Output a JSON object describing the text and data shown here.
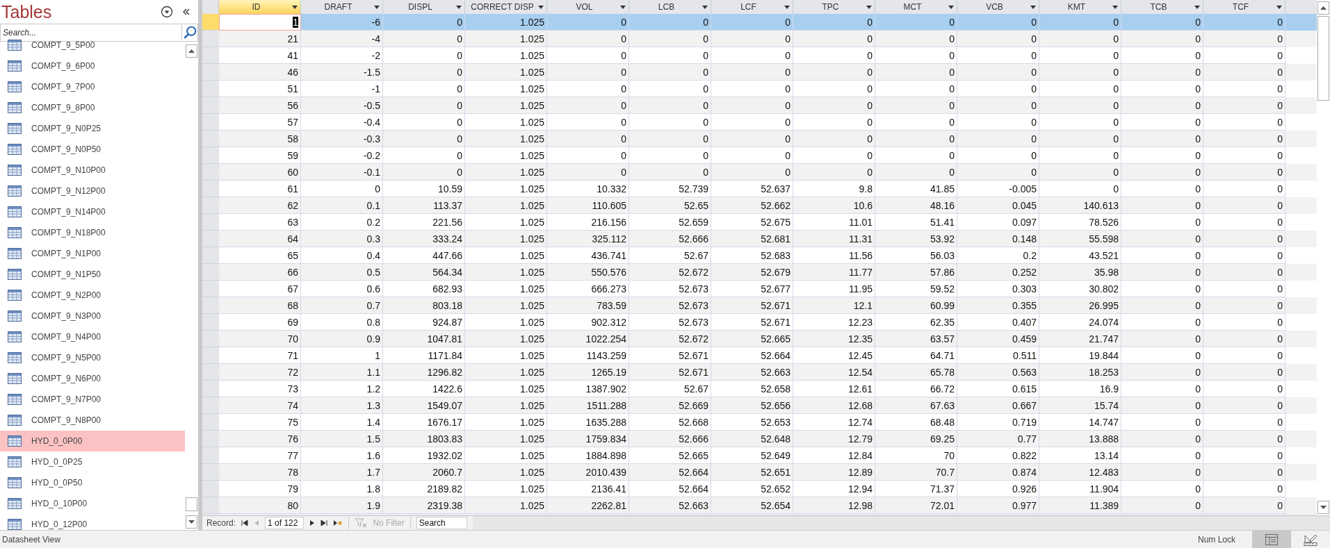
{
  "nav_pane": {
    "title": "Tables",
    "search": {
      "placeholder": "Search..."
    },
    "items": [
      {
        "label": "COMPT_9_5P00",
        "selected": false
      },
      {
        "label": "COMPT_9_6P00",
        "selected": false
      },
      {
        "label": "COMPT_9_7P00",
        "selected": false
      },
      {
        "label": "COMPT_9_8P00",
        "selected": false
      },
      {
        "label": "COMPT_9_N0P25",
        "selected": false
      },
      {
        "label": "COMPT_9_N0P50",
        "selected": false
      },
      {
        "label": "COMPT_9_N10P00",
        "selected": false
      },
      {
        "label": "COMPT_9_N12P00",
        "selected": false
      },
      {
        "label": "COMPT_9_N14P00",
        "selected": false
      },
      {
        "label": "COMPT_9_N18P00",
        "selected": false
      },
      {
        "label": "COMPT_9_N1P00",
        "selected": false
      },
      {
        "label": "COMPT_9_N1P50",
        "selected": false
      },
      {
        "label": "COMPT_9_N2P00",
        "selected": false
      },
      {
        "label": "COMPT_9_N3P00",
        "selected": false
      },
      {
        "label": "COMPT_9_N4P00",
        "selected": false
      },
      {
        "label": "COMPT_9_N5P00",
        "selected": false
      },
      {
        "label": "COMPT_9_N6P00",
        "selected": false
      },
      {
        "label": "COMPT_9_N7P00",
        "selected": false
      },
      {
        "label": "COMPT_9_N8P00",
        "selected": false
      },
      {
        "label": "HYD_0_0P00",
        "selected": true
      },
      {
        "label": "HYD_0_0P25",
        "selected": false
      },
      {
        "label": "HYD_0_0P50",
        "selected": false
      },
      {
        "label": "HYD_0_10P00",
        "selected": false
      },
      {
        "label": "HYD_0_12P00",
        "selected": false
      }
    ]
  },
  "table": {
    "columns": [
      "ID",
      "DRAFT",
      "DISPL",
      "CORRECT DISP",
      "VOL",
      "LCB",
      "LCF",
      "TPC",
      "MCT",
      "VCB",
      "KMT",
      "TCB",
      "TCF"
    ],
    "rows": [
      {
        "selected": true,
        "cells": [
          "1",
          "-6",
          "0",
          "1.025",
          "0",
          "0",
          "0",
          "0",
          "0",
          "0",
          "0",
          "0",
          "0"
        ]
      },
      {
        "selected": false,
        "cells": [
          "21",
          "-4",
          "0",
          "1.025",
          "0",
          "0",
          "0",
          "0",
          "0",
          "0",
          "0",
          "0",
          "0"
        ]
      },
      {
        "selected": false,
        "cells": [
          "41",
          "-2",
          "0",
          "1.025",
          "0",
          "0",
          "0",
          "0",
          "0",
          "0",
          "0",
          "0",
          "0"
        ]
      },
      {
        "selected": false,
        "cells": [
          "46",
          "-1.5",
          "0",
          "1.025",
          "0",
          "0",
          "0",
          "0",
          "0",
          "0",
          "0",
          "0",
          "0"
        ]
      },
      {
        "selected": false,
        "cells": [
          "51",
          "-1",
          "0",
          "1.025",
          "0",
          "0",
          "0",
          "0",
          "0",
          "0",
          "0",
          "0",
          "0"
        ]
      },
      {
        "selected": false,
        "cells": [
          "56",
          "-0.5",
          "0",
          "1.025",
          "0",
          "0",
          "0",
          "0",
          "0",
          "0",
          "0",
          "0",
          "0"
        ]
      },
      {
        "selected": false,
        "cells": [
          "57",
          "-0.4",
          "0",
          "1.025",
          "0",
          "0",
          "0",
          "0",
          "0",
          "0",
          "0",
          "0",
          "0"
        ]
      },
      {
        "selected": false,
        "cells": [
          "58",
          "-0.3",
          "0",
          "1.025",
          "0",
          "0",
          "0",
          "0",
          "0",
          "0",
          "0",
          "0",
          "0"
        ]
      },
      {
        "selected": false,
        "cells": [
          "59",
          "-0.2",
          "0",
          "1.025",
          "0",
          "0",
          "0",
          "0",
          "0",
          "0",
          "0",
          "0",
          "0"
        ]
      },
      {
        "selected": false,
        "cells": [
          "60",
          "-0.1",
          "0",
          "1.025",
          "0",
          "0",
          "0",
          "0",
          "0",
          "0",
          "0",
          "0",
          "0"
        ]
      },
      {
        "selected": false,
        "cells": [
          "61",
          "0",
          "10.59",
          "1.025",
          "10.332",
          "52.739",
          "52.637",
          "9.8",
          "41.85",
          "-0.005",
          "0",
          "0",
          "0"
        ]
      },
      {
        "selected": false,
        "cells": [
          "62",
          "0.1",
          "113.37",
          "1.025",
          "110.605",
          "52.65",
          "52.662",
          "10.6",
          "48.16",
          "0.045",
          "140.613",
          "0",
          "0"
        ]
      },
      {
        "selected": false,
        "cells": [
          "63",
          "0.2",
          "221.56",
          "1.025",
          "216.156",
          "52.659",
          "52.675",
          "11.01",
          "51.41",
          "0.097",
          "78.526",
          "0",
          "0"
        ]
      },
      {
        "selected": false,
        "cells": [
          "64",
          "0.3",
          "333.24",
          "1.025",
          "325.112",
          "52.666",
          "52.681",
          "11.31",
          "53.92",
          "0.148",
          "55.598",
          "0",
          "0"
        ]
      },
      {
        "selected": false,
        "cells": [
          "65",
          "0.4",
          "447.66",
          "1.025",
          "436.741",
          "52.67",
          "52.683",
          "11.56",
          "56.03",
          "0.2",
          "43.521",
          "0",
          "0"
        ]
      },
      {
        "selected": false,
        "cells": [
          "66",
          "0.5",
          "564.34",
          "1.025",
          "550.576",
          "52.672",
          "52.679",
          "11.77",
          "57.86",
          "0.252",
          "35.98",
          "0",
          "0"
        ]
      },
      {
        "selected": false,
        "cells": [
          "67",
          "0.6",
          "682.93",
          "1.025",
          "666.273",
          "52.673",
          "52.677",
          "11.95",
          "59.52",
          "0.303",
          "30.802",
          "0",
          "0"
        ]
      },
      {
        "selected": false,
        "cells": [
          "68",
          "0.7",
          "803.18",
          "1.025",
          "783.59",
          "52.673",
          "52.671",
          "12.1",
          "60.99",
          "0.355",
          "26.995",
          "0",
          "0"
        ]
      },
      {
        "selected": false,
        "cells": [
          "69",
          "0.8",
          "924.87",
          "1.025",
          "902.312",
          "52.673",
          "52.671",
          "12.23",
          "62.35",
          "0.407",
          "24.074",
          "0",
          "0"
        ]
      },
      {
        "selected": false,
        "cells": [
          "70",
          "0.9",
          "1047.81",
          "1.025",
          "1022.254",
          "52.672",
          "52.665",
          "12.35",
          "63.57",
          "0.459",
          "21.747",
          "0",
          "0"
        ]
      },
      {
        "selected": false,
        "cells": [
          "71",
          "1",
          "1171.84",
          "1.025",
          "1143.259",
          "52.671",
          "52.664",
          "12.45",
          "64.71",
          "0.511",
          "19.844",
          "0",
          "0"
        ]
      },
      {
        "selected": false,
        "cells": [
          "72",
          "1.1",
          "1296.82",
          "1.025",
          "1265.19",
          "52.671",
          "52.663",
          "12.54",
          "65.78",
          "0.563",
          "18.253",
          "0",
          "0"
        ]
      },
      {
        "selected": false,
        "cells": [
          "73",
          "1.2",
          "1422.6",
          "1.025",
          "1387.902",
          "52.67",
          "52.658",
          "12.61",
          "66.72",
          "0.615",
          "16.9",
          "0",
          "0"
        ]
      },
      {
        "selected": false,
        "cells": [
          "74",
          "1.3",
          "1549.07",
          "1.025",
          "1511.288",
          "52.669",
          "52.656",
          "12.68",
          "67.63",
          "0.667",
          "15.74",
          "0",
          "0"
        ]
      },
      {
        "selected": false,
        "cells": [
          "75",
          "1.4",
          "1676.17",
          "1.025",
          "1635.288",
          "52.668",
          "52.653",
          "12.74",
          "68.48",
          "0.719",
          "14.747",
          "0",
          "0"
        ]
      },
      {
        "selected": false,
        "cells": [
          "76",
          "1.5",
          "1803.83",
          "1.025",
          "1759.834",
          "52.666",
          "52.648",
          "12.79",
          "69.25",
          "0.77",
          "13.888",
          "0",
          "0"
        ]
      },
      {
        "selected": false,
        "cells": [
          "77",
          "1.6",
          "1932.02",
          "1.025",
          "1884.898",
          "52.665",
          "52.649",
          "12.84",
          "70",
          "0.822",
          "13.14",
          "0",
          "0"
        ]
      },
      {
        "selected": false,
        "cells": [
          "78",
          "1.7",
          "2060.7",
          "1.025",
          "2010.439",
          "52.664",
          "52.651",
          "12.89",
          "70.7",
          "0.874",
          "12.483",
          "0",
          "0"
        ]
      },
      {
        "selected": false,
        "cells": [
          "79",
          "1.8",
          "2189.82",
          "1.025",
          "2136.41",
          "52.664",
          "52.652",
          "12.94",
          "71.37",
          "0.926",
          "11.904",
          "0",
          "0"
        ]
      },
      {
        "selected": false,
        "cells": [
          "80",
          "1.9",
          "2319.38",
          "1.025",
          "2262.81",
          "52.663",
          "52.654",
          "12.98",
          "72.01",
          "0.977",
          "11.389",
          "0",
          "0"
        ]
      }
    ]
  },
  "record_nav": {
    "label": "Record:",
    "position": "1 of 122",
    "filter": "No Filter",
    "search": "Search"
  },
  "status_bar": {
    "text": "Datasheet View",
    "num_lock": "Num Lock"
  }
}
